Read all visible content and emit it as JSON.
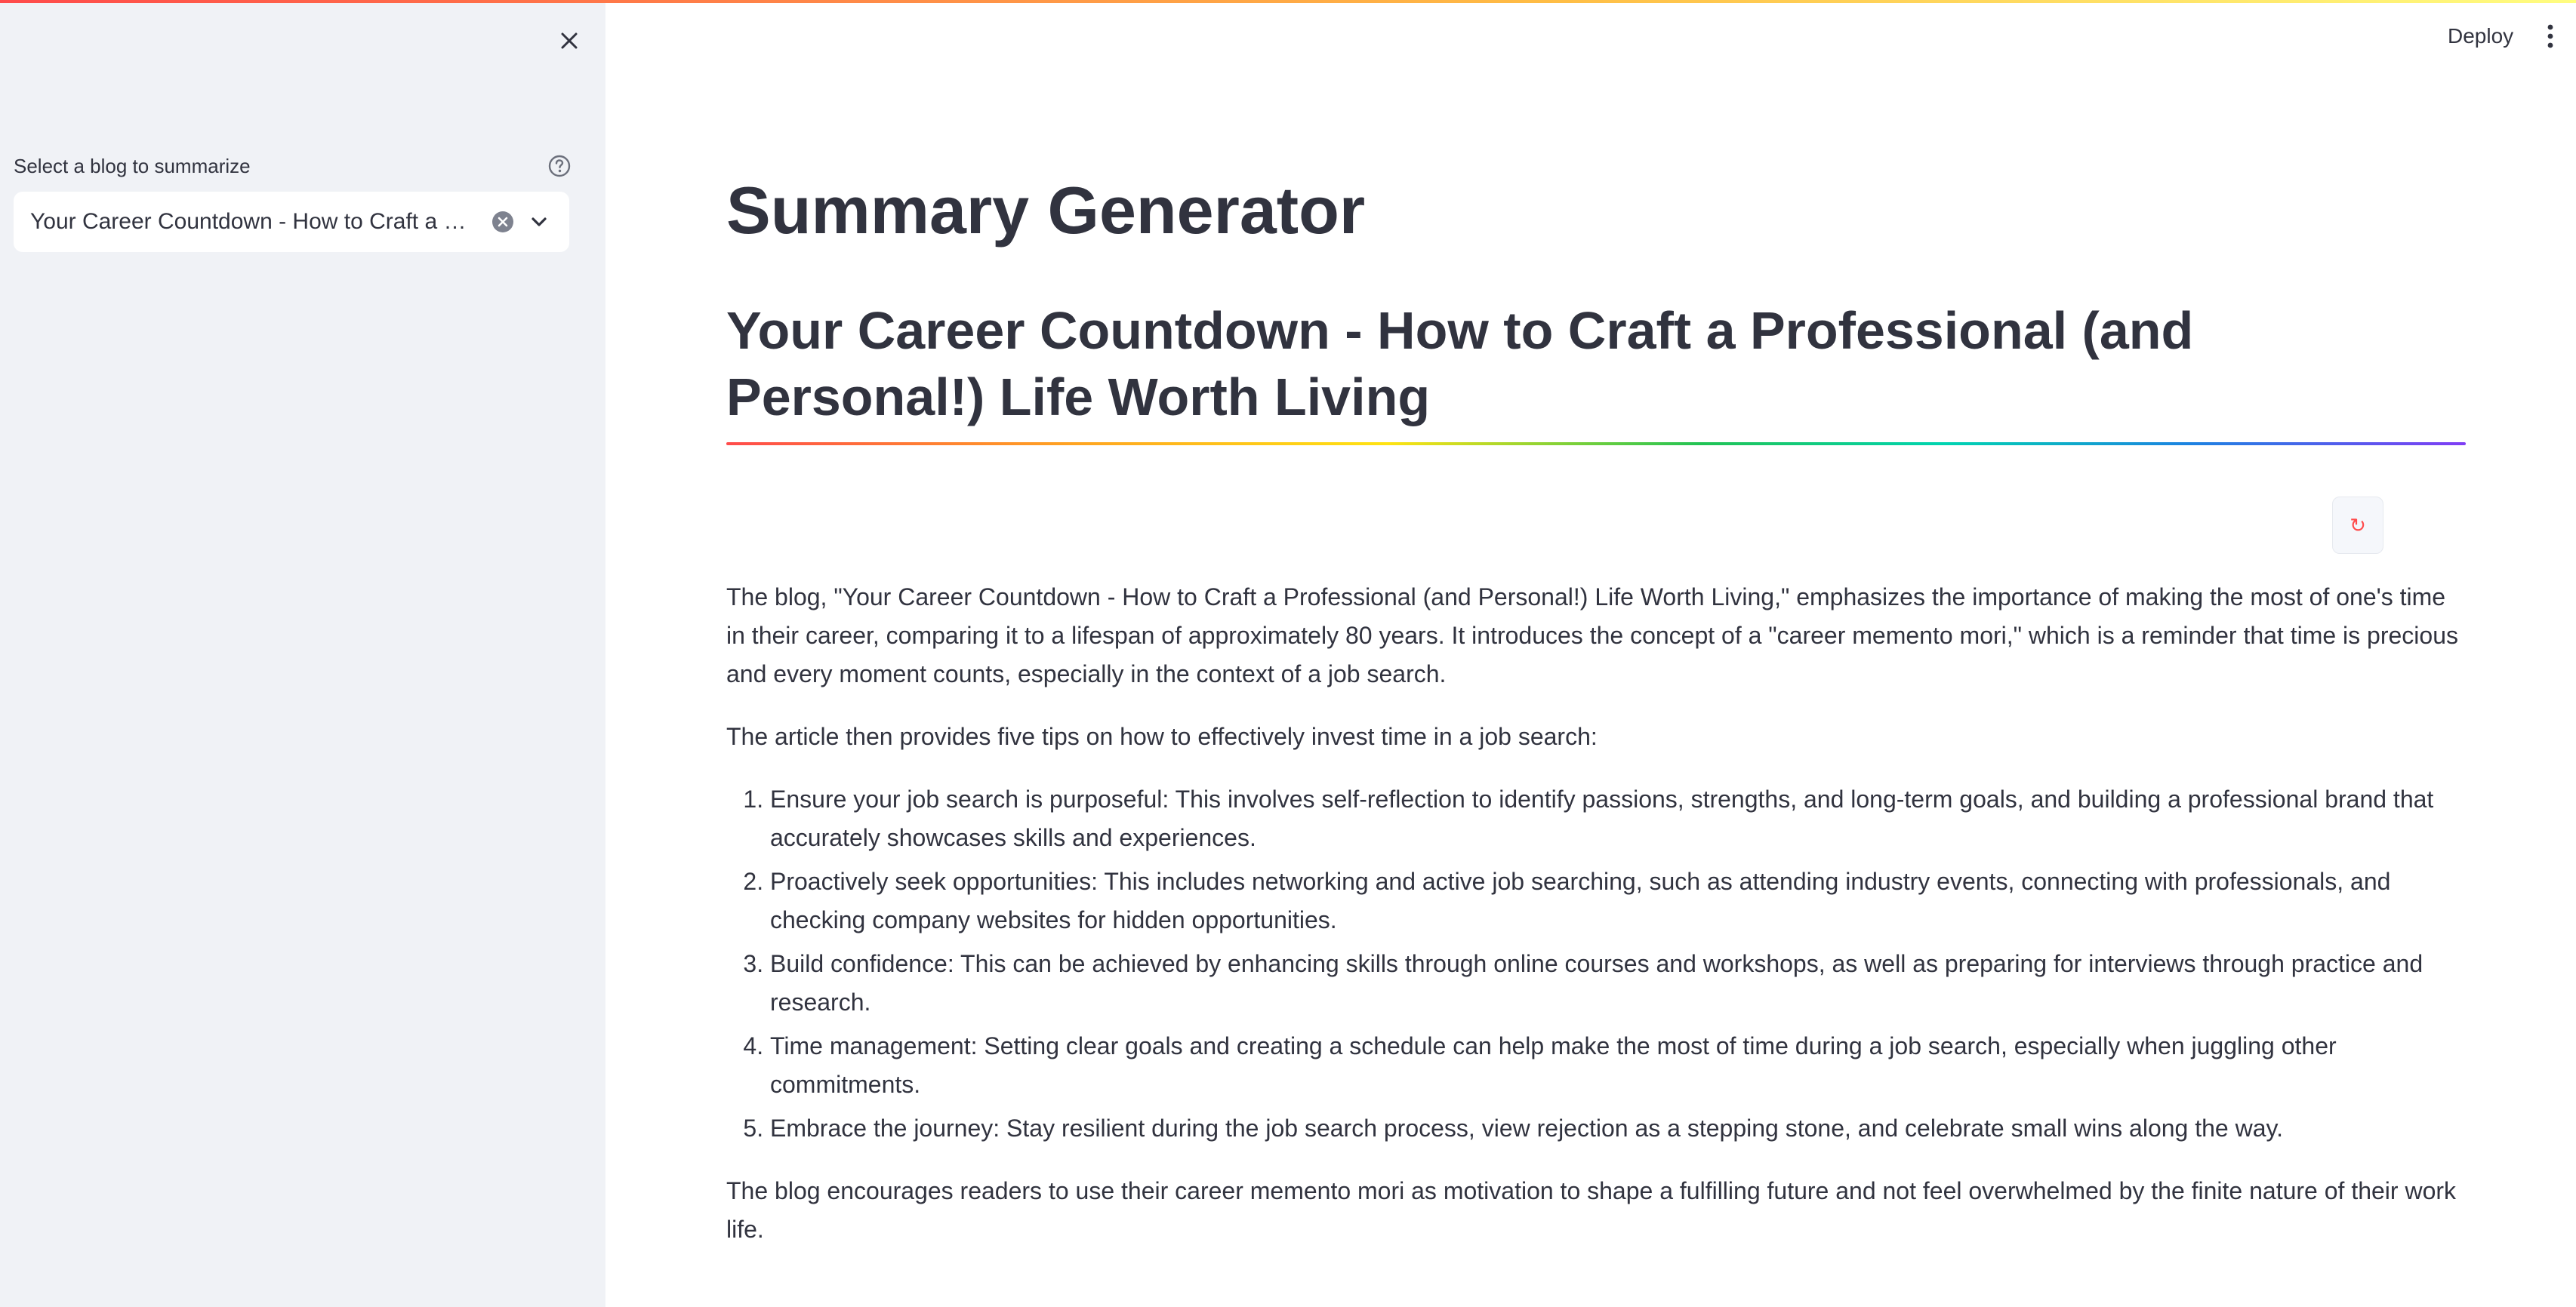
{
  "sidebar": {
    "close_icon": "close-icon",
    "select_label": "Select a blog to summarize",
    "help_icon": "help-circle-icon",
    "selected_value": "Your Career Countdown - How to Craft a …",
    "clear_icon": "clear-circle-icon",
    "chevron_icon": "chevron-down-icon"
  },
  "header": {
    "deploy_label": "Deploy",
    "menu_icon": "vertical-dots-icon"
  },
  "main": {
    "page_title": "Summary Generator",
    "blog_title": "Your Career Countdown - How to Craft a Professional (and Personal!) Life Worth Living",
    "rerun_icon": "↻",
    "summary": {
      "intro": "The blog, \"Your Career Countdown - How to Craft a Professional (and Personal!) Life Worth Living,\" emphasizes the importance of making the most of one's time in their career, comparing it to a lifespan of approximately 80 years. It introduces the concept of a \"career memento mori,\" which is a reminder that time is precious and every moment counts, especially in the context of a job search.",
      "tips_intro": "The article then provides five tips on how to effectively invest time in a job search:",
      "tips": [
        "Ensure your job search is purposeful: This involves self-reflection to identify passions, strengths, and long-term goals, and building a professional brand that accurately showcases skills and experiences.",
        "Proactively seek opportunities: This includes networking and active job searching, such as attending industry events, connecting with professionals, and checking company websites for hidden opportunities.",
        "Build confidence: This can be achieved by enhancing skills through online courses and workshops, as well as preparing for interviews through practice and research.",
        "Time management: Setting clear goals and creating a schedule can help make the most of time during a job search, especially when juggling other commitments.",
        "Embrace the journey: Stay resilient during the job search process, view rejection as a stepping stone, and celebrate small wins along the way."
      ],
      "conclusion": "The blog encourages readers to use their career memento mori as motivation to shape a fulfilling future and not feel overwhelmed by the finite nature of their work life."
    }
  },
  "colors": {
    "sidebar_bg": "#f0f2f6",
    "text": "#31333F",
    "accent": "#ff4b4b"
  }
}
